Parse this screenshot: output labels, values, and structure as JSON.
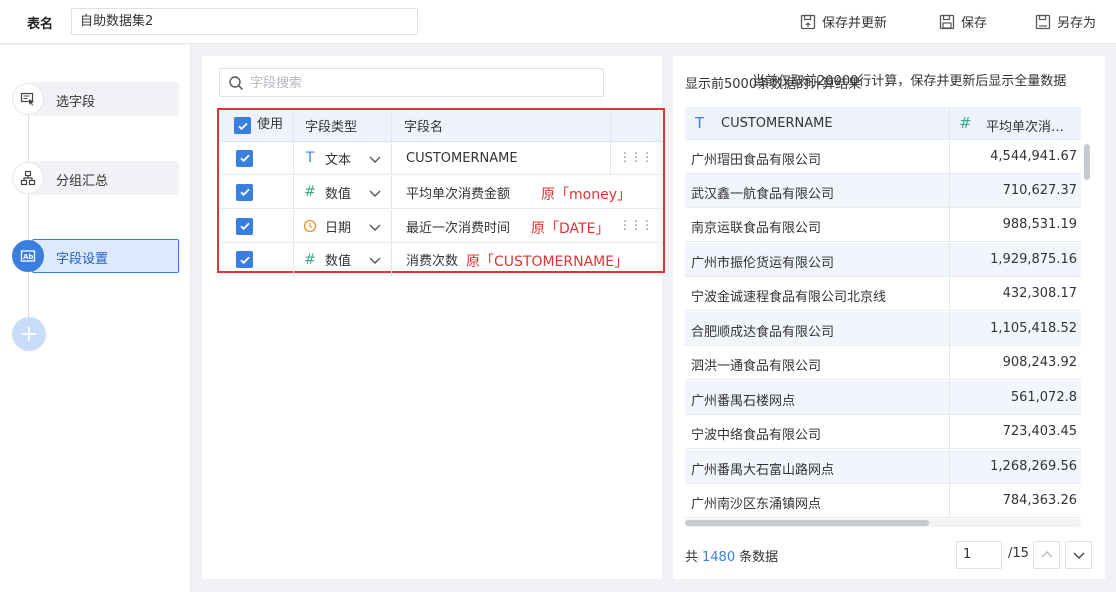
{
  "header": {
    "table_name_label": "表名",
    "table_name_value": "自助数据集2",
    "save_update_label": "保存并更新",
    "save_label": "保存",
    "save_as_label": "另存为"
  },
  "sidebar": {
    "steps": [
      {
        "label": "选字段",
        "icon": "select-field-icon"
      },
      {
        "label": "分组汇总",
        "icon": "group-summary-icon"
      },
      {
        "label": "字段设置",
        "icon": "field-settings-icon",
        "active": true
      }
    ],
    "add_label": "+"
  },
  "field_panel": {
    "search_placeholder": "字段搜索",
    "columns": {
      "use": "使用",
      "type": "字段类型",
      "name": "字段名"
    },
    "rows": [
      {
        "checked": true,
        "type_icon": "T",
        "type_label": "文本",
        "name": "CUSTOMERNAME",
        "original": ""
      },
      {
        "checked": true,
        "type_icon": "#",
        "type_label": "数值",
        "name": "平均单次消费金额",
        "original": "原「money」"
      },
      {
        "checked": true,
        "type_icon": "clock",
        "type_label": "日期",
        "name": "最近一次消费时间",
        "original": "原「DATE」"
      },
      {
        "checked": true,
        "type_icon": "#",
        "type_label": "数值",
        "name": "消费次数",
        "original": "原「CUSTOMERNAME」"
      }
    ],
    "grip": "⋮⋮⋮"
  },
  "preview": {
    "title_a": "显示前5000条数据的计算结果",
    "title_b": "当前仅取前20000行计算，保存并更新后显示全量数据",
    "columns": [
      {
        "icon": "T",
        "label": "CUSTOMERNAME"
      },
      {
        "icon": "#",
        "label": "平均单次消…"
      }
    ],
    "rows": [
      {
        "name": "广州瑁田食品有限公司",
        "value": "4,544,941.67"
      },
      {
        "name": "武汉鑫一航食品有限公司",
        "value": "710,627.37"
      },
      {
        "name": "南京运联食品有限公司",
        "value": "988,531.19"
      },
      {
        "name": "广州市振伦货运有限公司",
        "value": "1,929,875.16"
      },
      {
        "name": "宁波金诚速程食品有限公司北京线",
        "value": "432,308.17"
      },
      {
        "name": "合肥顺成达食品有限公司",
        "value": "1,105,418.52"
      },
      {
        "name": "泗洪一通食品有限公司",
        "value": "908,243.92"
      },
      {
        "name": "广州番禺石楼网点",
        "value": "561,072.8"
      },
      {
        "name": "宁波中络食品有限公司",
        "value": "723,403.45"
      },
      {
        "name": "广州番禺大石富山路网点",
        "value": "1,268,269.56"
      },
      {
        "name": "广州南沙区东涌镇网点",
        "value": "784,363.26"
      }
    ],
    "footer": {
      "prefix": "共",
      "total": "1480",
      "suffix": "条数据",
      "page": "1",
      "page_total": "/15"
    }
  },
  "colors": {
    "accent": "#3a7ee0",
    "highlight_border": "#e03434",
    "numeric_icon": "#3aa88c",
    "date_icon": "#e8952e"
  }
}
